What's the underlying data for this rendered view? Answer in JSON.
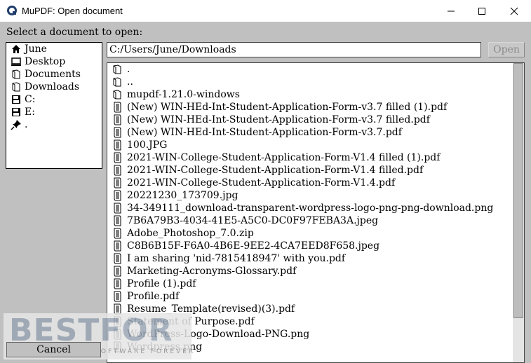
{
  "window": {
    "title": "MuPDF: Open document"
  },
  "prompt": "Select a document to open:",
  "places": [
    {
      "icon": "home-icon",
      "label": "June"
    },
    {
      "icon": "desktop-icon",
      "label": "Desktop"
    },
    {
      "icon": "folder-icon",
      "label": "Documents"
    },
    {
      "icon": "folder-icon",
      "label": "Downloads"
    },
    {
      "icon": "disk-icon",
      "label": "C:"
    },
    {
      "icon": "disk-icon",
      "label": "E:"
    },
    {
      "icon": "pin-icon",
      "label": "."
    }
  ],
  "path": "C:/Users/June/Downloads",
  "open_label": "Open",
  "cancel_label": "Cancel",
  "files": [
    {
      "kind": "folder",
      "name": "."
    },
    {
      "kind": "folder",
      "name": ".."
    },
    {
      "kind": "folder",
      "name": "mupdf-1.21.0-windows"
    },
    {
      "kind": "file",
      "name": "(New) WIN-HEd-Int-Student-Application-Form-v3.7 filled (1).pdf"
    },
    {
      "kind": "file",
      "name": "(New) WIN-HEd-Int-Student-Application-Form-v3.7 filled.pdf"
    },
    {
      "kind": "file",
      "name": "(New) WIN-HEd-Int-Student-Application-Form-v3.7.pdf"
    },
    {
      "kind": "file",
      "name": "100.JPG"
    },
    {
      "kind": "file",
      "name": "2021-WIN-College-Student-Application-Form-V1.4 filled (1).pdf"
    },
    {
      "kind": "file",
      "name": "2021-WIN-College-Student-Application-Form-V1.4 filled.pdf"
    },
    {
      "kind": "file",
      "name": "2021-WIN-College-Student-Application-Form-V1.4.pdf"
    },
    {
      "kind": "file",
      "name": "20221230_173709.jpg"
    },
    {
      "kind": "file",
      "name": "34-349111_download-transparent-wordpress-logo-png-png-download.png"
    },
    {
      "kind": "file",
      "name": "7B6A79B3-4034-41E5-A5C0-DC0F97FEBA3A.jpeg"
    },
    {
      "kind": "file",
      "name": "Adobe_Photoshop_7.0.zip"
    },
    {
      "kind": "file",
      "name": "C8B6B15F-F6A0-4B6E-9EE2-4CA7EED8F658.jpeg"
    },
    {
      "kind": "file",
      "name": "I am sharing 'nid-7815418947' with you.pdf"
    },
    {
      "kind": "file",
      "name": "Marketing-Acronyms-Glossary.pdf"
    },
    {
      "kind": "file",
      "name": "Profile (1).pdf"
    },
    {
      "kind": "file",
      "name": "Profile.pdf"
    },
    {
      "kind": "file",
      "name": "Resume_Template(revised)(3).pdf"
    },
    {
      "kind": "file",
      "name": "Statement of Purpose.pdf"
    },
    {
      "kind": "file",
      "name": "WordPress-Logo-Download-PNG.png"
    },
    {
      "kind": "file",
      "name": "Wordpress.png"
    }
  ],
  "watermark": {
    "brand": "BESTFOR",
    "tagline": "DOWNLOAD BEST SOFTWARE FOREVER"
  }
}
